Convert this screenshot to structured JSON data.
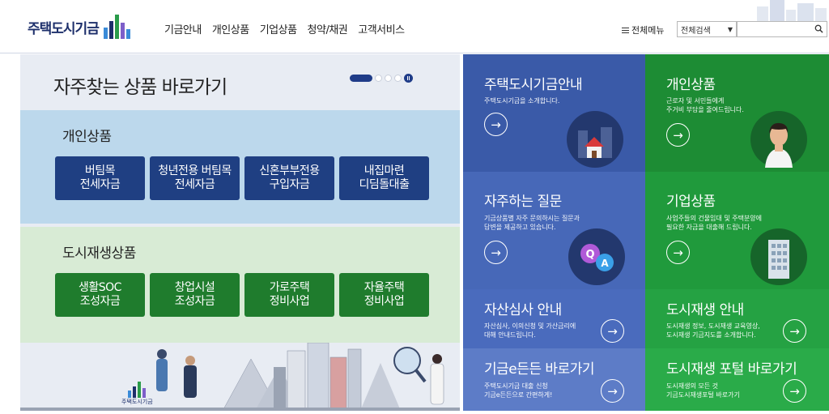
{
  "header": {
    "logo_text": "주택도시기금",
    "nav": [
      "기금안내",
      "개인상품",
      "기업상품",
      "청약/채권",
      "고객서비스"
    ],
    "all_menu": "전체메뉴",
    "search_select": "전체검색",
    "search_placeholder": ""
  },
  "left": {
    "title": "자주찾는 상품 바로가기",
    "personal": {
      "title": "개인상품",
      "buttons": [
        "버팀목\n전세자금",
        "청년전용 버팀목\n전세자금",
        "신혼부부전용\n구입자금",
        "내집마련\n디딤돌대출"
      ]
    },
    "urban": {
      "title": "도시재생상품",
      "buttons": [
        "생활SOC\n조성자금",
        "창업시설\n조성자금",
        "가로주택\n정비사업",
        "자율주택\n정비사업"
      ]
    },
    "illus_logo": "주택도시기금"
  },
  "tiles": [
    {
      "title": "주택도시기금안내",
      "desc": "주택도시기금을 소개합니다.",
      "color": "#3a5aa8"
    },
    {
      "title": "개인상품",
      "desc": "근로자 및 서민들에게\n주거비 부담을 줄여드립니다.",
      "color": "#1d8c34"
    },
    {
      "title": "자주하는 질문",
      "desc": "기금상품별 자주 문의하시는 질문과\n답변을 제공하고 있습니다.",
      "color": "#4768b8"
    },
    {
      "title": "기업상품",
      "desc": "사업주들의 건물임대 및 주택분양에\n필요한 자금을 대출해 드립니다.",
      "color": "#209a3c"
    },
    {
      "title": "자산심사 안내",
      "desc": "자산심사, 이의신청 및 가산금리에\n대해 안내드립니다.",
      "color": "#4a6bbd"
    },
    {
      "title": "도시재생 안내",
      "desc": "도시재생 정보, 도시재생 교육영상,\n도시재생 기금지도를 소개합니다.",
      "color": "#25a243"
    },
    {
      "title": "기금e든든 바로가기",
      "desc": "주택도시기금 대출 신청\n기금e든든으로 간편하게!",
      "color": "#5d7cc7"
    },
    {
      "title": "도시재생 포털 바로가기",
      "desc": "도시재생의 모든 것\n기금도시재생포털 바로가기",
      "color": "#2aab49"
    }
  ],
  "arrow_glyph": "→"
}
